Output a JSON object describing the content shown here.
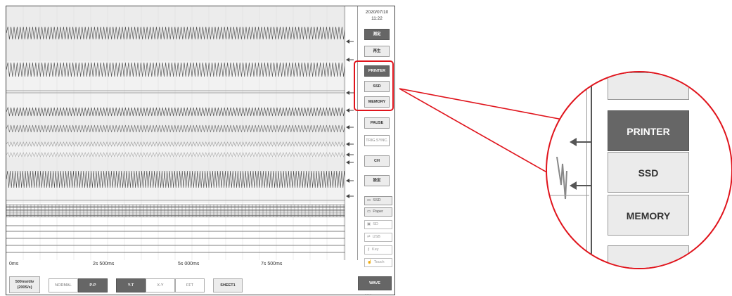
{
  "screen": {
    "datetime_date": "2020/07/10",
    "datetime_time": "11:22",
    "time_axis": [
      "0ms",
      "2s 500ms",
      "5s 000ms",
      "7s 500ms"
    ],
    "side_buttons": {
      "measure": "測定",
      "playback": "再生",
      "printer": "PRINTER",
      "ssd": "SSD",
      "memory": "MEMORY",
      "pause": "PAUSE",
      "trig_sync": "TRIG.SYNC.",
      "ch": "CH",
      "settings": "設定"
    },
    "media": [
      {
        "icon": "ssd-icon",
        "label": "SSD",
        "glyph": "▭"
      },
      {
        "icon": "paper-icon",
        "label": "Paper",
        "glyph": "▭"
      },
      {
        "icon": "sd-icon",
        "label": "SD",
        "glyph": "▣"
      },
      {
        "icon": "usb-icon",
        "label": "USB",
        "glyph": "⇌"
      },
      {
        "icon": "key-icon",
        "label": "Key",
        "glyph": "⚷"
      },
      {
        "icon": "touch-icon",
        "label": "Touch",
        "glyph": "☝"
      }
    ],
    "bottom": {
      "timebase": "500ms/div",
      "timebase_sub": "(200S/s)",
      "normal": "NORMAL",
      "pp": "P-P",
      "yt": "Y-T",
      "xy": "X-Y",
      "fft": "FFT",
      "sheet": "SHEET1",
      "wave": "WAVE",
      "page_dots": "• • • •"
    }
  },
  "zoom": {
    "top_partial": "",
    "printer": "PRINTER",
    "ssd": "SSD",
    "memory": "MEMORY"
  },
  "colors": {
    "highlight": "#e0141c",
    "button_dark": "#666666",
    "button_light": "#ececec"
  }
}
